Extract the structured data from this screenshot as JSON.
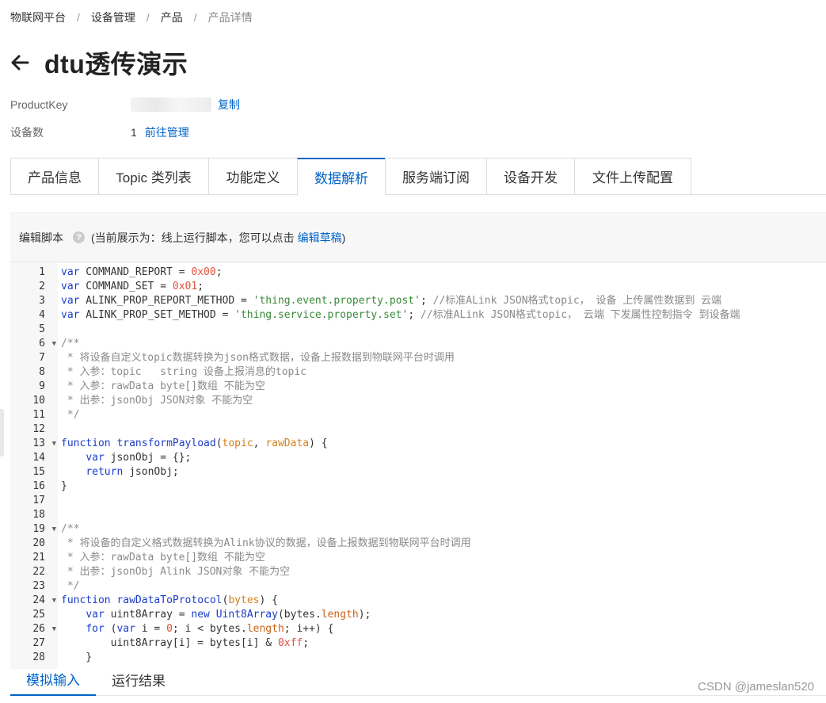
{
  "breadcrumb": [
    "物联网平台",
    "设备管理",
    "产品",
    "产品详情"
  ],
  "page": {
    "title": "dtu透传演示"
  },
  "meta": {
    "product_key_label": "ProductKey",
    "copy_label": "复制",
    "device_count_label": "设备数",
    "device_count": "1",
    "manage_link": "前往管理"
  },
  "tabs": [
    "产品信息",
    "Topic 类列表",
    "功能定义",
    "数据解析",
    "服务端订阅",
    "设备开发",
    "文件上传配置"
  ],
  "active_tab": "数据解析",
  "editor": {
    "title": "编辑脚本",
    "help_icon": "?",
    "note_prefix": "(当前展示为：线上运行脚本，您可以点击",
    "edit_draft_link": "编辑草稿",
    "note_suffix": ")"
  },
  "code_lines": [
    "var COMMAND_REPORT = 0x00;",
    "var COMMAND_SET = 0x01;",
    "var ALINK_PROP_REPORT_METHOD = 'thing.event.property.post'; //标准ALink JSON格式topic， 设备 上传属性数据到 云端",
    "var ALINK_PROP_SET_METHOD = 'thing.service.property.set'; //标准ALink JSON格式topic， 云端 下发属性控制指令 到设备端",
    "",
    "/**",
    " * 将设备自定义topic数据转换为json格式数据，设备上报数据到物联网平台时调用",
    " * 入参：topic   string 设备上报消息的topic",
    " * 入参：rawData byte[]数组 不能为空",
    " * 出参：jsonObj JSON对象 不能为空",
    " */",
    "",
    "function transformPayload(topic, rawData) {",
    "    var jsonObj = {};",
    "    return jsonObj;",
    "}",
    "",
    "",
    "/**",
    " * 将设备的自定义格式数据转换为Alink协议的数据，设备上报数据到物联网平台时调用",
    " * 入参：rawData byte[]数组 不能为空",
    " * 出参：jsonObj Alink JSON对象 不能为空",
    " */",
    "function rawDataToProtocol(bytes) {",
    "    var uint8Array = new Uint8Array(bytes.length);",
    "    for (var i = 0; i < bytes.length; i++) {",
    "        uint8Array[i] = bytes[i] & 0xff;",
    "    }"
  ],
  "fold_lines": [
    6,
    13,
    19,
    24,
    26
  ],
  "bottom_tabs": [
    "模拟输入",
    "运行结果"
  ],
  "active_bottom_tab": "模拟输入",
  "watermark": "CSDN @jameslan520",
  "colors": {
    "accent": "#0064c8"
  }
}
